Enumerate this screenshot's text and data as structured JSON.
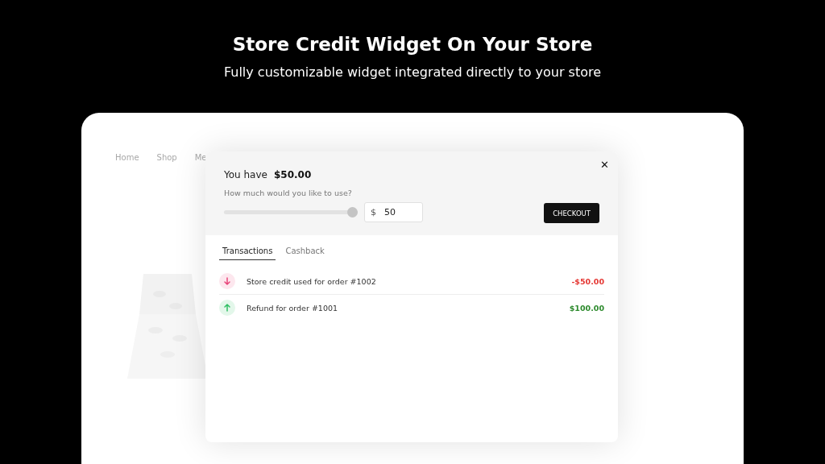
{
  "header": {
    "title": "Store Credit Widget On Your Store",
    "subtitle": "Fully customizable widget integrated directly to your store"
  },
  "store": {
    "nav": [
      "Home",
      "Shop",
      "Me"
    ]
  },
  "widget": {
    "balance_label": "You have",
    "balance": "$50.00",
    "prompt": "How much would you like to use?",
    "slider": {
      "level": 1.0
    },
    "amount": {
      "prefix": "$",
      "value": "50"
    },
    "checkout": "CHECKOUT",
    "close": "✕",
    "tabs": [
      {
        "label": "Transactions",
        "selected": true
      },
      {
        "label": "Cashback",
        "selected": false
      }
    ],
    "transactions": [
      {
        "kind": "debit",
        "description": "Store credit used for order #1002",
        "amount": "-$50.00"
      },
      {
        "kind": "credit",
        "description": "Refund for order #1001",
        "amount": "$100.00"
      }
    ]
  }
}
